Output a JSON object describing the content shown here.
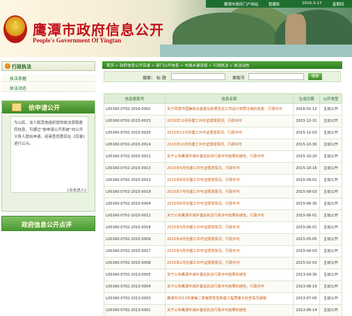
{
  "header": {
    "title": "鹰潭市政府信息公开",
    "subtitle": "People's Government Of Yingtan",
    "topbar": {
      "portal_link": "鹰潭市政府门户网站",
      "favorite_link": "暂藏影",
      "date": "2016-3-17",
      "weekday": "星期四"
    }
  },
  "sidebar": {
    "section_title": "行政执法",
    "items": [
      {
        "label": "执法依据"
      },
      {
        "label": "执法动态"
      }
    ],
    "apply_box": {
      "title": "依申请公开",
      "body": "为公民、法人和其他组织提供依法获取政府信息，可通过“依申请公开系统”向公开义务人提出申请，经审查同意后在《目录》进行公示。",
      "link": "[点击进入]"
    },
    "review_button": "政府信息公开点评"
  },
  "main": {
    "breadcrumb": "首页 > 政府信息公开目录 > 部门公开信息 > 市城乡建设局 > 行政执法 > 执法动态",
    "search": {
      "label": "搜索： 标 题",
      "title_placeholder": "",
      "id_label": "索取号",
      "id_placeholder": "",
      "button": "搜索"
    },
    "table": {
      "headers": [
        "信息索取号",
        "信息名称",
        "生成日期",
        "公开类型"
      ],
      "rows": [
        [
          "L00160-0702-2016-0002",
          "关于同意中国第四冶金建设有限责任公司设计资质注销的批复、行政许可",
          "2016-01-12",
          "主动公开"
        ],
        [
          "L00160-0702-2015-0023",
          "2015年12月份建工许可证颁发情况、行政许可",
          "2015-12-31",
          "主动公开"
        ],
        [
          "L00160-0702-2015-0020",
          "2015年11月份建工许可证颁发情况、行政许可",
          "2015-12-03",
          "主动公开"
        ],
        [
          "L00160-0702-2015-0014",
          "2015年10月份建工许可证颁发情况、行政许可",
          "2015-10-30",
          "主动公开"
        ],
        [
          "L00160-0702-2015-0021",
          "关于公布鹰潭市城乡建设执法行政许可结果的通告、行政许可",
          "2015-10-20",
          "主动公开"
        ],
        [
          "L00160-0702-2015-0013",
          "2015年9月份建工许可证颁发情况、行政许可",
          "2015-10-16",
          "主动公开"
        ],
        [
          "L00160-0702-2015-0010",
          "2015年8月份建工许可证颁发情况、行政许可",
          "2015-09-01",
          "主动公开"
        ],
        [
          "L00160-0702-2015-0019",
          "2015年7月份建工许可证颁发情况、行政许可",
          "2015-08-03",
          "主动公开"
        ],
        [
          "L00160-0702-2015-0004",
          "2015年6月份建工许可证颁发情况、行政许可",
          "2015-06-30",
          "主动公开"
        ],
        [
          "L00160-0702-2015-0012",
          "关于公布鹰潭市城乡建设执法行政许可结果的通告、行政许可",
          "2015-06-01",
          "主动公开"
        ],
        [
          "L00160-0702-2015-0018",
          "2015年5月份建工许可证颁发情况、行政许可",
          "2015-06-01",
          "主动公开"
        ],
        [
          "L00160-0702-2015-0009",
          "2015年4月份建工许可证颁发情况、行政许可",
          "2015-05-05",
          "主动公开"
        ],
        [
          "L00160-0702-2015-0017",
          "2015年3月份建工许可证颁发情况、行政许可",
          "2015-04-03",
          "主动公开"
        ],
        [
          "L00160-0702-2015-0008",
          "2015年2月份建工许可证颁发情况、行政许可",
          "2015-02-03",
          "主动公开"
        ],
        [
          "L00160-0702-2013-0005",
          "关于公布鹰潭市城乡建设执法行政许可结果的通告",
          "2013-09-30",
          "主动公开"
        ],
        [
          "L00160-0702-2013-0004",
          "关于公布鹰潭市城乡建设执法行政许可结果的通告、行政许可",
          "2013-08-19",
          "主动公开"
        ],
        [
          "L00160-0702-2013-0003",
          "鹰潭市2013年度第二季度限性性新建工程质量大检查情况通报",
          "2013-07-05",
          "主动公开"
        ],
        [
          "L00160-0702-2013-0001",
          "关于公布鹰潭市城乡建设执法行政许可结果的通告",
          "2013-06-14",
          "主动公开"
        ],
        [
          "L00160-0702-2013-0002",
          "关于2013年一季度全市建筑施工安全生产督查情况的通报",
          "2013-05-13",
          "主动公开"
        ]
      ]
    }
  }
}
